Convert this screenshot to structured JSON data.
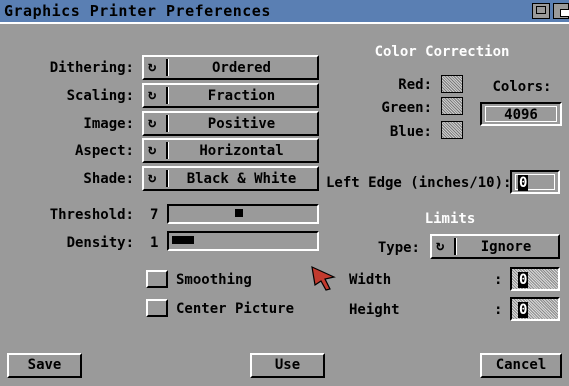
{
  "window": {
    "title": "Graphics Printer Preferences"
  },
  "options": [
    {
      "label": "Dithering:",
      "value": "Ordered"
    },
    {
      "label": "Scaling:",
      "value": "Fraction"
    },
    {
      "label": "Image:",
      "value": "Positive"
    },
    {
      "label": "Aspect:",
      "value": "Horizontal"
    },
    {
      "label": "Shade:",
      "value": "Black & White"
    }
  ],
  "threshold": {
    "label": "Threshold:",
    "value": "7",
    "level": 7,
    "max": 15
  },
  "density": {
    "label": "Density:",
    "value": "1",
    "level": 1,
    "max": 7
  },
  "checkboxes": [
    {
      "label": "Smoothing",
      "checked": false
    },
    {
      "label": "Center Picture",
      "checked": false
    }
  ],
  "color_correction": {
    "heading": "Color Correction",
    "red_label": "Red:",
    "green_label": "Green:",
    "blue_label": "Blue:",
    "colors_label": "Colors:",
    "colors_value": "4096"
  },
  "left_edge": {
    "label": "Left Edge (inches/10):",
    "value": "0"
  },
  "limits": {
    "heading": "Limits",
    "type_label": "Type:",
    "type_value": "Ignore",
    "width_label": "Width",
    "width_colon": ":",
    "width_value": "0",
    "height_label": "Height",
    "height_colon": ":",
    "height_value": "0"
  },
  "buttons": {
    "save": "Save",
    "use": "Use",
    "cancel": "Cancel"
  },
  "icons": {
    "cycle": "cycle-gadget-icon",
    "pointer": "mouse-pointer-icon"
  }
}
